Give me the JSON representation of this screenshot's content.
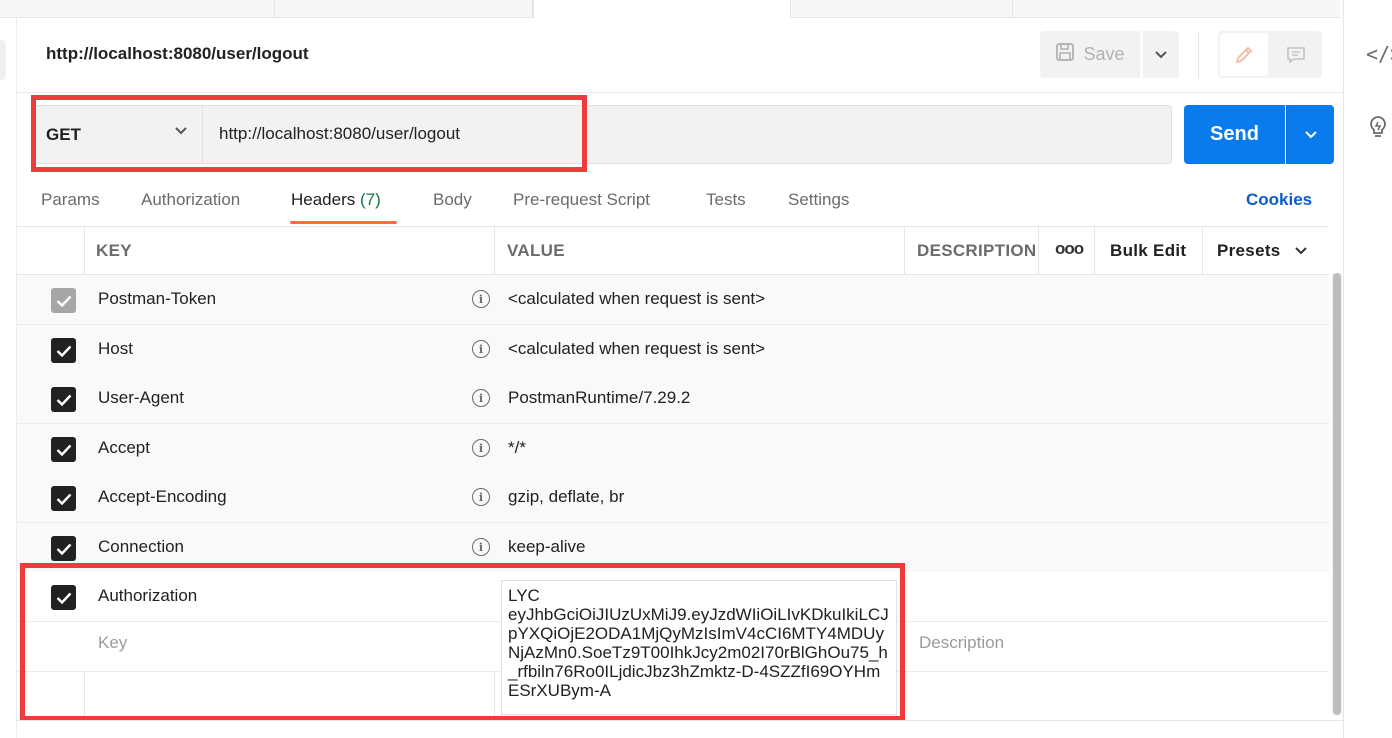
{
  "request": {
    "title": "http://localhost:8080/user/logout",
    "method": "GET",
    "url": "http://localhost:8080/user/logout"
  },
  "toolbar": {
    "save_label": "Save",
    "send_label": "Send"
  },
  "tabs": [
    {
      "label": "Params"
    },
    {
      "label": "Authorization"
    },
    {
      "label": "Headers",
      "count": "(7)",
      "active": true
    },
    {
      "label": "Body"
    },
    {
      "label": "Pre-request Script"
    },
    {
      "label": "Tests"
    },
    {
      "label": "Settings"
    }
  ],
  "cookies_label": "Cookies",
  "headers_table": {
    "columns": {
      "key": "KEY",
      "value": "VALUE",
      "description": "DESCRIPTION",
      "more": "ooo",
      "bulk_edit": "Bulk Edit",
      "presets": "Presets"
    },
    "rows": [
      {
        "key": "Postman-Token",
        "value": "<calculated when request is sent>",
        "checked": true,
        "disabled": true
      },
      {
        "key": "Host",
        "value": "<calculated when request is sent>",
        "checked": true
      },
      {
        "key": "User-Agent",
        "value": "PostmanRuntime/7.29.2",
        "checked": true
      },
      {
        "key": "Accept",
        "value": "*/*",
        "checked": true
      },
      {
        "key": "Accept-Encoding",
        "value": "gzip, deflate, br",
        "checked": true
      },
      {
        "key": "Connection",
        "value": "keep-alive",
        "checked": true
      },
      {
        "key": "Authorization",
        "value": "LYC\neyJhbGciOiJIUzUxMiJ9.eyJzdWIiOiLIvKDkuIkiLCJpYXQiOjE2ODA1MjQyMzIsImV4cCI6MTY4MDUyNjAzMn0.SoeTz9T00IhkJcy2m02I70rBlGhOu75_h_rfbiln76Ro0ILjdicJbz3hZmktz-D-4SZZfI69OYHmESrXUBym-A",
        "checked": true
      }
    ],
    "key_placeholder": "Key",
    "description_placeholder": "Description"
  },
  "icons": {
    "code": "code-icon",
    "bulb": "lightbulb-icon",
    "save": "save-icon",
    "edit": "pencil-icon",
    "comment": "comment-icon"
  },
  "colors": {
    "send": "#097bed",
    "tab_indicator": "#ff6c37",
    "count": "#0f7b42",
    "cookies": "#0b5ccf",
    "highlight": "#ef3b3b"
  }
}
